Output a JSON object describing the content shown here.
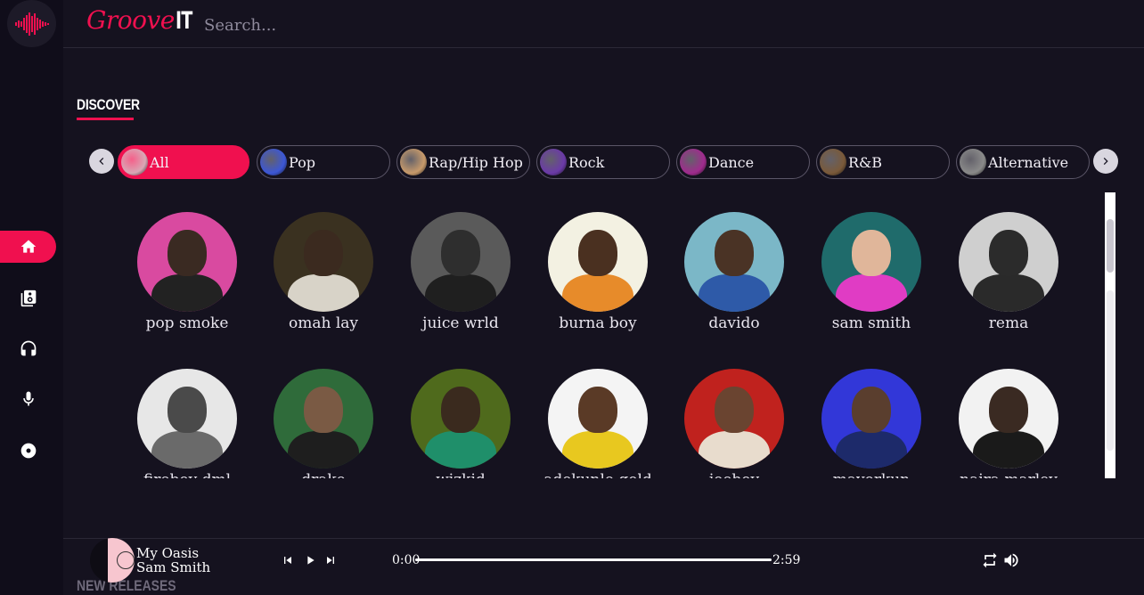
{
  "brand": {
    "script": "Groove",
    "suffix": "IT"
  },
  "search": {
    "placeholder": "Search..."
  },
  "sidebar": {
    "items": [
      {
        "name": "home",
        "icon": "home-icon",
        "active": true
      },
      {
        "name": "library",
        "icon": "speaker-library-icon",
        "active": false
      },
      {
        "name": "headphones",
        "icon": "headphones-icon",
        "active": false
      },
      {
        "name": "microphone",
        "icon": "microphone-icon",
        "active": false
      },
      {
        "name": "disc",
        "icon": "disc-icon",
        "active": false
      }
    ]
  },
  "discover": {
    "title": "DISCOVER",
    "genres": [
      {
        "label": "All",
        "active": true,
        "thumb": "#d9a7b5"
      },
      {
        "label": "Pop",
        "active": false,
        "thumb": "#3c57d6"
      },
      {
        "label": "Rap/Hip Hop",
        "active": false,
        "thumb": "#c79a6b"
      },
      {
        "label": "Rock",
        "active": false,
        "thumb": "#6b3aa8"
      },
      {
        "label": "Dance",
        "active": false,
        "thumb": "#a02b8e"
      },
      {
        "label": "R&B",
        "active": false,
        "thumb": "#7a5a3a"
      },
      {
        "label": "Alternative",
        "active": false,
        "thumb": "#8a8a8a"
      }
    ],
    "artists": [
      {
        "name": "pop smoke",
        "bg": "#d94aa0",
        "skin": "#3a2a22",
        "cloth": "#222222"
      },
      {
        "name": "omah lay",
        "bg": "#3a3120",
        "skin": "#3b2a1f",
        "cloth": "#d8d3c8"
      },
      {
        "name": "juice wrld",
        "bg": "#5a5a5a",
        "skin": "#2e2e2e",
        "cloth": "#1f1f1f"
      },
      {
        "name": "burna boy",
        "bg": "#f3f1e2",
        "skin": "#4a3020",
        "cloth": "#e78b2a"
      },
      {
        "name": "davido",
        "bg": "#7bb7c7",
        "skin": "#4a3325",
        "cloth": "#2e5aa8"
      },
      {
        "name": "sam smith",
        "bg": "#1f6b6b",
        "skin": "#e0b69a",
        "cloth": "#e03cc4"
      },
      {
        "name": "rema",
        "bg": "#cfcfcf",
        "skin": "#2b2b2b",
        "cloth": "#2a2a2a"
      },
      {
        "name": "fireboy dml",
        "bg": "#e7e7e7",
        "skin": "#4a4a4a",
        "cloth": "#6a6a6a"
      },
      {
        "name": "drake",
        "bg": "#2f6b3a",
        "skin": "#7a5a44",
        "cloth": "#1e1e1e"
      },
      {
        "name": "wizkid",
        "bg": "#4f6a1c",
        "skin": "#3a2a1e",
        "cloth": "#1f8f6a"
      },
      {
        "name": "adekunle gold",
        "bg": "#f4f4f4",
        "skin": "#5a3a26",
        "cloth": "#e8c81f"
      },
      {
        "name": "joeboy",
        "bg": "#c0221e",
        "skin": "#6a4430",
        "cloth": "#e8dccd"
      },
      {
        "name": "mayorkun",
        "bg": "#3237d8",
        "skin": "#5a3e2e",
        "cloth": "#1d2a6a"
      },
      {
        "name": "naira marley",
        "bg": "#f2f2f2",
        "skin": "#3a2a22",
        "cloth": "#1a1a1a"
      }
    ]
  },
  "player": {
    "track_title": "My Oasis",
    "track_artist": "Sam Smith",
    "current_time": "0:00",
    "duration": "2:59",
    "progress": 0
  },
  "new_releases": {
    "title": "NEW RELEASES"
  },
  "colors": {
    "accent": "#f0104f",
    "background": "#15121f",
    "sidebar": "#100d1a"
  }
}
